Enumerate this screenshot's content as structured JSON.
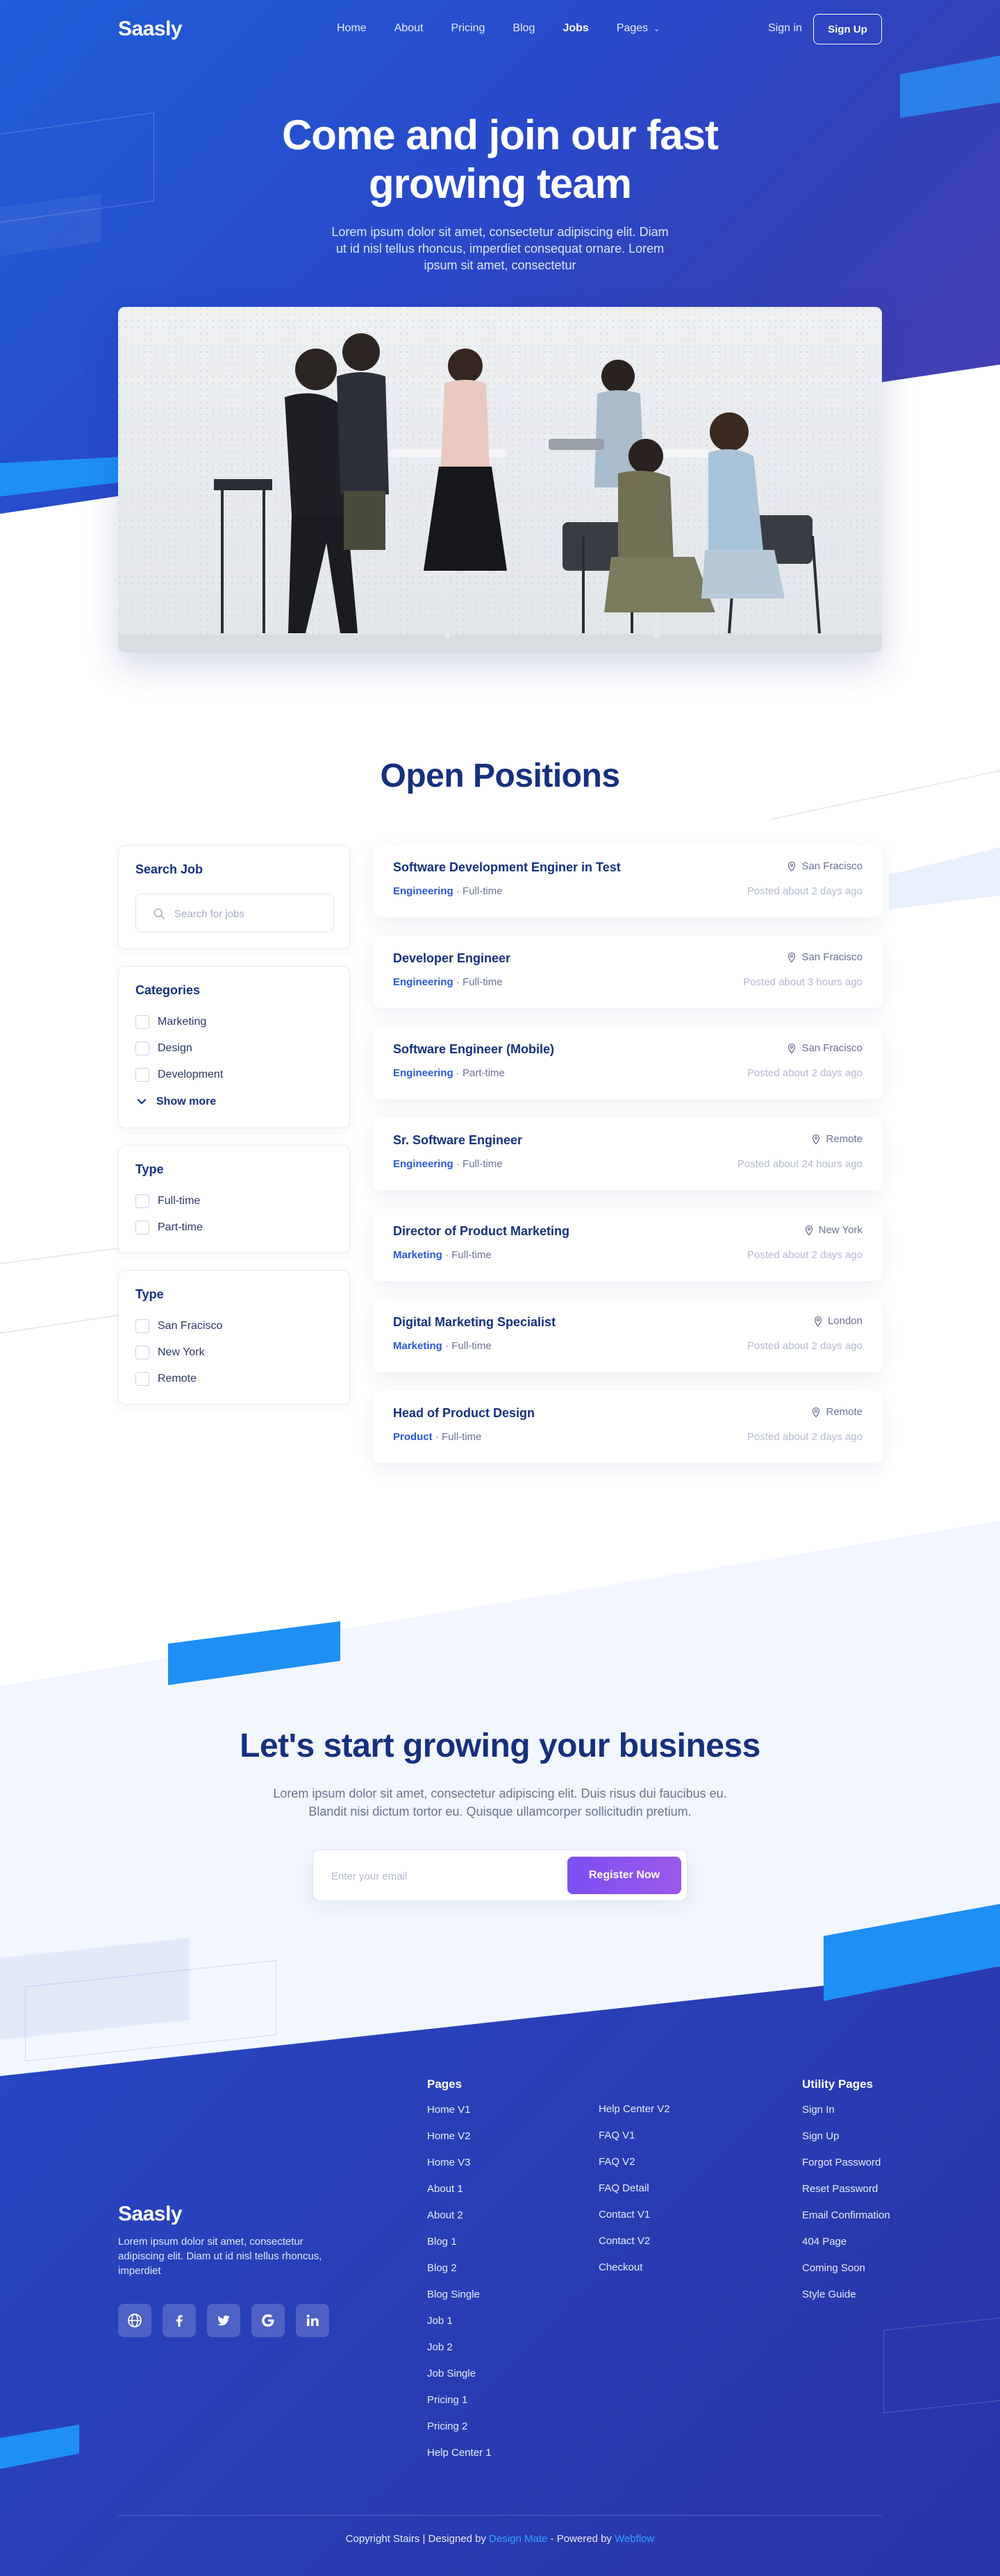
{
  "nav": {
    "logo": "Saasly",
    "links": [
      "Home",
      "About",
      "Pricing",
      "Blog",
      "Jobs",
      "Pages"
    ],
    "active": "Jobs",
    "signin": "Sign in",
    "signup": "Sign Up"
  },
  "hero": {
    "title_line1": "Come and join our fast",
    "title_line2": "growing team",
    "subtitle": "Lorem ipsum dolor sit amet, consectetur adipiscing elit. Diam ut id nisl tellus rhoncus, imperdiet consequat ornare. Lorem ipsum sit amet, consectetur"
  },
  "positions": {
    "title": "Open Positions",
    "search_heading": "Search Job",
    "search_placeholder": "Search for jobs",
    "categories_heading": "Categories",
    "categories": [
      "Marketing",
      "Design",
      "Development"
    ],
    "show_more": "Show more",
    "type_heading": "Type",
    "types": [
      "Full-time",
      "Part-time"
    ],
    "location_heading": "Type",
    "locations": [
      "San Fracisco",
      "New York",
      "Remote"
    ],
    "separator": " · ",
    "jobs": [
      {
        "title": "Software Development Enginer in Test",
        "category": "Engineering",
        "type": "Full-time",
        "location": "San Fracisco",
        "posted": "Posted about 2 days ago"
      },
      {
        "title": "Developer Engineer",
        "category": "Engineering",
        "type": "Full-time",
        "location": "San Fracisco",
        "posted": "Posted about 3 hours ago"
      },
      {
        "title": "Software Engineer (Mobile)",
        "category": "Engineering",
        "type": "Part-time",
        "location": "San Fracisco",
        "posted": "Posted about 2 days ago"
      },
      {
        "title": "Sr. Software Engineer",
        "category": "Engineering",
        "type": "Full-time",
        "location": "Remote",
        "posted": "Posted about 24 hours ago"
      },
      {
        "title": "Director of Product Marketing",
        "category": "Marketing",
        "type": "Full-time",
        "location": "New York",
        "posted": "Posted about 2 days ago"
      },
      {
        "title": "Digital Marketing Specialist",
        "category": "Marketing",
        "type": "Full-time",
        "location": "London",
        "posted": "Posted about 2 days ago"
      },
      {
        "title": "Head of Product Design",
        "category": "Product",
        "type": "Full-time",
        "location": "Remote",
        "posted": "Posted about 2 days ago"
      }
    ]
  },
  "cta": {
    "title": "Let's start growing your business",
    "subtitle": "Lorem ipsum dolor sit amet, consectetur adipiscing elit. Duis risus dui faucibus eu. Blandit nisi dictum tortor eu. Quisque ullamcorper sollicitudin pretium.",
    "email_placeholder": "Enter your email",
    "button": "Register Now"
  },
  "footer": {
    "logo": "Saasly",
    "description": "Lorem ipsum dolor sit amet, consectetur adipiscing elit. Diam ut id nisl tellus rhoncus, imperdiet",
    "socials": [
      "globe-icon",
      "facebook-icon",
      "twitter-icon",
      "google-icon",
      "linkedin-icon"
    ],
    "pages_heading": "Pages",
    "pages_col1": [
      "Home V1",
      "Home V2",
      "Home V3",
      "About 1",
      "About 2",
      "Blog 1",
      "Blog 2",
      "Blog Single",
      "Job 1",
      "Job 2",
      "Job Single",
      "Pricing 1",
      "Pricing 2",
      "Help Center 1"
    ],
    "pages_col2": [
      "Help Center V2",
      "FAQ V1",
      "FAQ V2",
      "FAQ Detail",
      "Contact V1",
      "Contact V2",
      "Checkout"
    ],
    "utility_heading": "Utility Pages",
    "utility": [
      "Sign In",
      "Sign Up",
      "Forgot Password",
      "Reset Password",
      "Email Confirmation",
      "404 Page",
      "Coming Soon",
      "Style Guide"
    ],
    "copyright_prefix": "Copyright Stairs | Designed by",
    "designer": "Design Mate",
    "powered_prefix": "- Powered by",
    "platform": "Webflow"
  },
  "colors": {
    "brand_blue": "#2548c6",
    "heading_navy": "#16307e",
    "accent_cyan": "#1e8ff5",
    "button_purple": "#8a54ee",
    "category_blue": "#2b57d9"
  }
}
